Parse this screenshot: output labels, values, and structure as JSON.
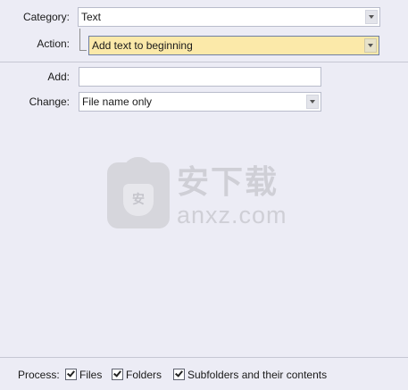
{
  "category": {
    "label": "Category:",
    "value": "Text"
  },
  "action": {
    "label": "Action:",
    "value": "Add text to beginning"
  },
  "add": {
    "label": "Add:",
    "value": ""
  },
  "change": {
    "label": "Change:",
    "value": "File name only"
  },
  "watermark": {
    "cn": "安下载",
    "en": "anxz.com",
    "badge": "安"
  },
  "process": {
    "label": "Process:",
    "files": {
      "label": "Files",
      "checked": true
    },
    "folders": {
      "label": "Folders",
      "checked": true
    },
    "subfolders": {
      "label": "Subfolders and their contents",
      "checked": true
    }
  },
  "colors": {
    "background": "#ececf5",
    "highlight": "#fbe9a9"
  }
}
